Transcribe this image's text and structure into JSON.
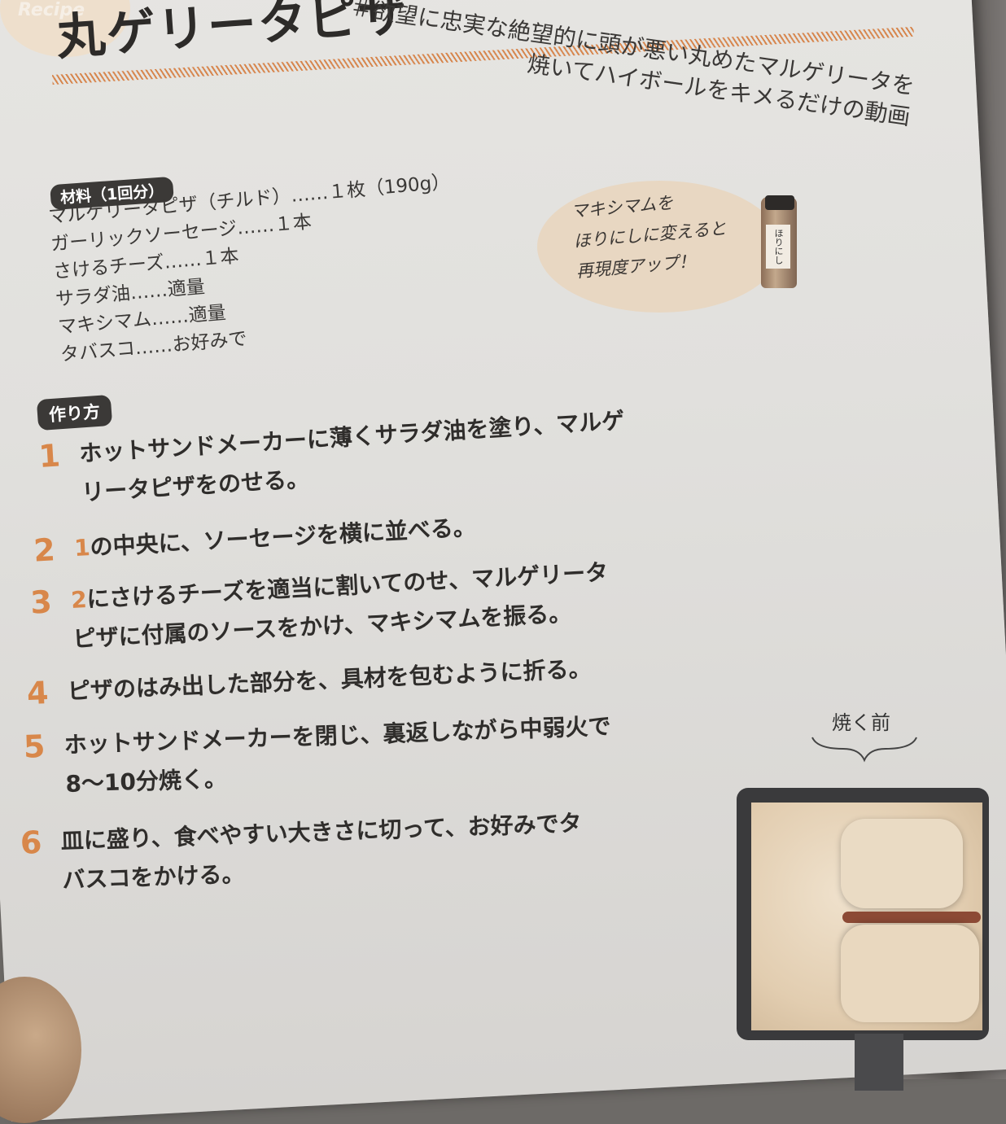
{
  "header": {
    "badge": "Recipe",
    "title": "丸ゲリータピザ",
    "subtitle_line1": "＃欲望に忠実な絶望的に頭が悪い丸めたマルゲリータを",
    "subtitle_line2": "焼いてハイボールをキメるだけの動画"
  },
  "ingredients": {
    "label": "材料（1回分）",
    "items": [
      "マルゲリータピザ（チルド）……１枚（190g）",
      "ガーリックソーセージ……１本",
      "さけるチーズ……１本",
      "サラダ油……適量",
      "マキシマム……適量",
      "タバスコ……お好みで"
    ]
  },
  "tip": {
    "line1": "マキシマムを",
    "line2": "ほりにしに変えると",
    "line3": "再現度アップ！",
    "bottle_label": "ほりにし"
  },
  "method": {
    "label": "作り方",
    "steps": [
      {
        "num": "1",
        "ref": "",
        "line1": "ホットサンドメーカーに薄くサラダ油を塗り、マルゲ",
        "line2": "リータピザをのせる。"
      },
      {
        "num": "2",
        "ref": "1",
        "line1": "の中央に、ソーセージを横に並べる。",
        "line2": ""
      },
      {
        "num": "3",
        "ref": "2",
        "line1": "にさけるチーズを適当に割いてのせ、マルゲリータ",
        "line2": "ピザに付属のソースをかけ、マキシマムを振る。"
      },
      {
        "num": "4",
        "ref": "",
        "line1": "ピザのはみ出した部分を、具材を包むように折る。",
        "line2": ""
      },
      {
        "num": "5",
        "ref": "",
        "line1": "ホットサンドメーカーを閉じ、裏返しながら中弱火で",
        "line2": "8～10分焼く。"
      },
      {
        "num": "6",
        "ref": "",
        "line1": "皿に盛り、食べやすい大きさに切って、お好みでタ",
        "line2": "バスコをかける。"
      }
    ]
  },
  "photo": {
    "caption": "焼く前"
  }
}
